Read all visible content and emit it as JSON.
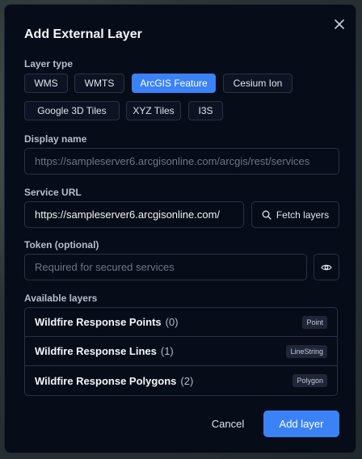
{
  "dialog": {
    "title": "Add External Layer",
    "close_icon": "close-icon"
  },
  "layer_type": {
    "label": "Layer type",
    "options": [
      "WMS",
      "WMTS",
      "ArcGIS Feature",
      "Cesium Ion",
      "Google 3D Tiles",
      "XYZ Tiles",
      "I3S"
    ],
    "selected": "ArcGIS Feature"
  },
  "display_name": {
    "label": "Display name",
    "value": "",
    "placeholder": "https://sampleserver6.arcgisonline.com/arcgis/rest/services"
  },
  "service_url": {
    "label": "Service URL",
    "value": "https://sampleserver6.arcgisonline.com/",
    "fetch_label": "Fetch layers",
    "fetch_icon": "search-icon"
  },
  "token": {
    "label": "Token (optional)",
    "value": "",
    "placeholder": "Required for secured services",
    "toggle_icon": "eye-icon"
  },
  "available_layers": {
    "label": "Available layers",
    "items": [
      {
        "name": "Wildfire Response Points",
        "count": "(0)",
        "type": "Point"
      },
      {
        "name": "Wildfire Response Lines",
        "count": "(1)",
        "type": "LineString"
      },
      {
        "name": "Wildfire Response Polygons",
        "count": "(2)",
        "type": "Polygon"
      }
    ]
  },
  "footer": {
    "cancel_label": "Cancel",
    "submit_label": "Add layer"
  },
  "colors": {
    "accent": "#3b82f6",
    "dialog_bg": "#060c18",
    "border": "#2a3242"
  }
}
